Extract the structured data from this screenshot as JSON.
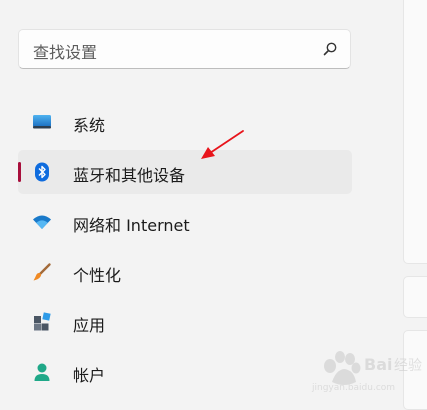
{
  "search": {
    "placeholder": "查找设置",
    "icon": "search-icon"
  },
  "nav": [
    {
      "label": "系统",
      "icon": "monitor-icon"
    },
    {
      "label": "蓝牙和其他设备",
      "icon": "bluetooth-icon",
      "selected": true
    },
    {
      "label": "网络和 Internet",
      "icon": "wifi-icon"
    },
    {
      "label": "个性化",
      "icon": "brush-icon"
    },
    {
      "label": "应用",
      "icon": "apps-icon"
    },
    {
      "label": "帐户",
      "icon": "account-icon"
    }
  ],
  "annotation": {
    "color": "#e8141b"
  },
  "colors": {
    "accent": "#a80f3c",
    "bluetooth": "#0f6cde"
  }
}
